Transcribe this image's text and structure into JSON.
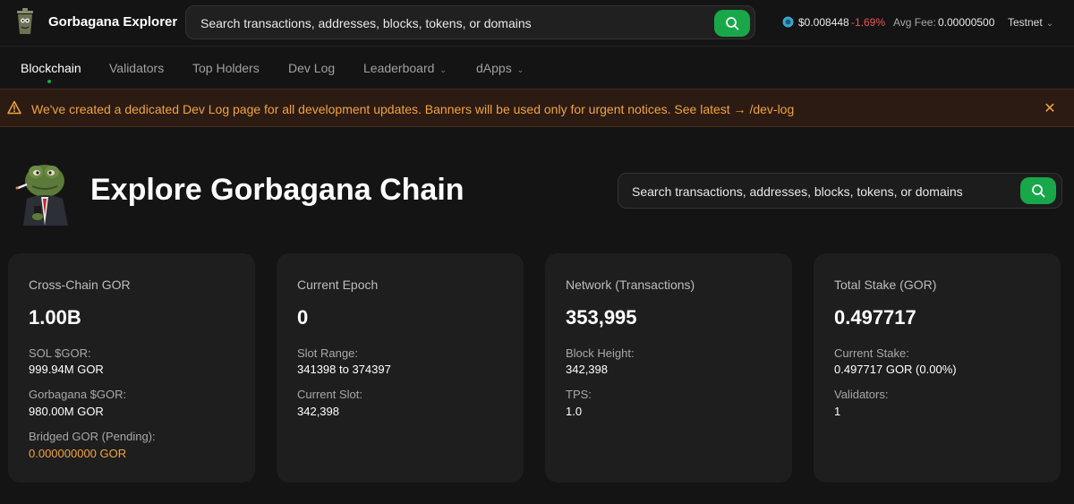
{
  "header": {
    "brand": "Gorbagana Explorer",
    "search_placeholder": "Search transactions, addresses, blocks, tokens, or domains",
    "price": "$0.008448",
    "price_change": "-1.69%",
    "avg_fee_label": "Avg Fee:",
    "avg_fee_value": "0.00000500",
    "network": "Testnet"
  },
  "nav": {
    "items": [
      {
        "label": "Blockchain"
      },
      {
        "label": "Validators"
      },
      {
        "label": "Top Holders"
      },
      {
        "label": "Dev Log"
      },
      {
        "label": "Leaderboard"
      },
      {
        "label": "dApps"
      }
    ]
  },
  "banner": {
    "text": "We've created a dedicated Dev Log page for all development updates. Banners will be used only for urgent notices. See latest → /dev-log",
    "close": "✕"
  },
  "hero": {
    "title": "Explore Gorbagana Chain",
    "search_placeholder": "Search transactions, addresses, blocks, tokens, or domains"
  },
  "cards": [
    {
      "title": "Cross-Chain GOR",
      "value": "1.00B",
      "stats": [
        {
          "label": "SOL $GOR:",
          "value": "999.94M GOR"
        },
        {
          "label": "Gorbagana $GOR:",
          "value": "980.00M GOR"
        },
        {
          "label": "Bridged GOR (Pending):",
          "value": "0.000000000 GOR"
        }
      ]
    },
    {
      "title": "Current Epoch",
      "value": "0",
      "stats": [
        {
          "label": "Slot Range:",
          "value": "341398 to 374397"
        },
        {
          "label": "Current Slot:",
          "value": "342,398"
        }
      ]
    },
    {
      "title": "Network (Transactions)",
      "value": "353,995",
      "stats": [
        {
          "label": "Block Height:",
          "value": "342,398"
        },
        {
          "label": "TPS:",
          "value": "1.0"
        }
      ]
    },
    {
      "title": "Total Stake (GOR)",
      "value": "0.497717",
      "stats": [
        {
          "label": "Current Stake:",
          "value": "0.497717 GOR (0.00%)"
        },
        {
          "label": "Validators:",
          "value": "1"
        }
      ]
    }
  ],
  "colors": {
    "accent_green": "#18a84a",
    "negative_red": "#f05454",
    "warning_orange": "#f2a33c"
  },
  "icons": {
    "logo": "trash-can-logo",
    "search": "search-icon",
    "price": "token-icon",
    "warning": "warning-triangle-icon",
    "close": "close-icon",
    "mascot": "frog-mascot"
  }
}
